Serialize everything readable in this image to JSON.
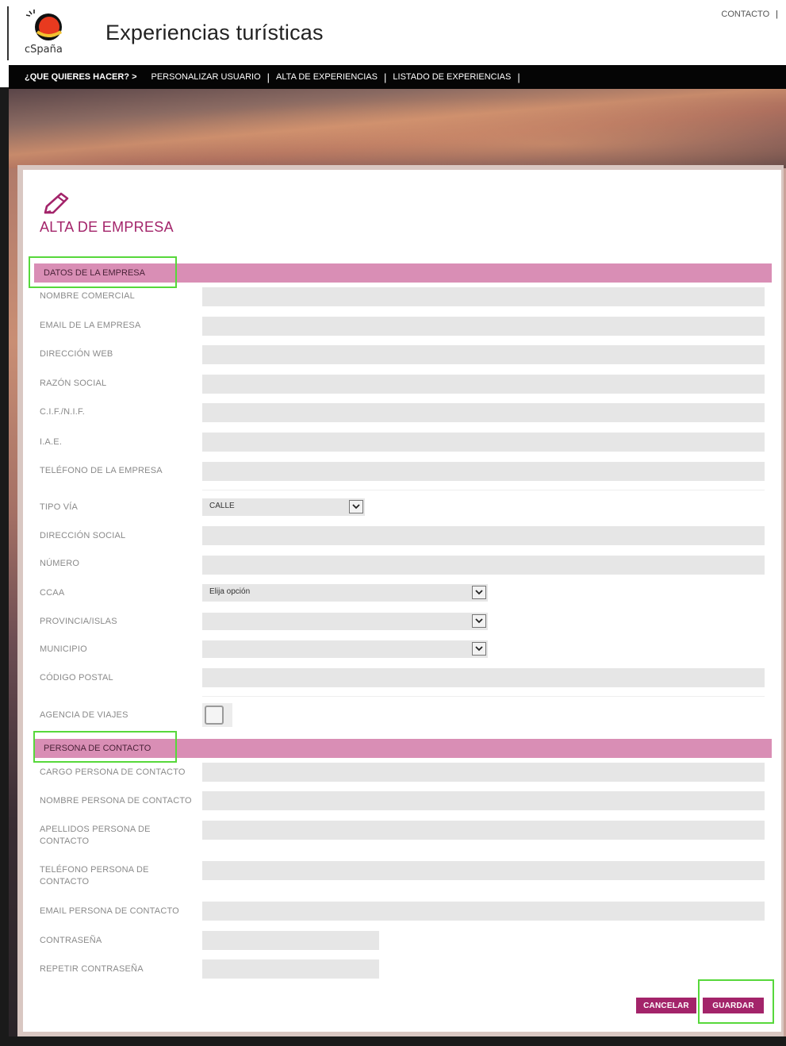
{
  "header": {
    "site_title": "Experiencias turísticas",
    "contact_link": "CONTACTO",
    "contact_separator": "|",
    "logo_icon": "spain-sun-logo-icon"
  },
  "nav": {
    "question": "¿QUE QUIERES HACER? >",
    "items": [
      {
        "label": "PERSONALIZAR USUARIO"
      },
      {
        "label": "ALTA DE EXPERIENCIAS"
      },
      {
        "label": "LISTADO DE EXPERIENCIAS"
      }
    ],
    "separator": "|"
  },
  "page": {
    "title": "ALTA DE EMPRESA",
    "title_icon": "pencil-icon",
    "accent_color": "#a3246a",
    "section_color": "#d98eb5"
  },
  "sections": {
    "empresa": {
      "label": "DATOS DE LA EMPRESA",
      "fields": [
        {
          "label": "NOMBRE COMERCIAL",
          "value": ""
        },
        {
          "label": "EMAIL DE LA EMPRESA",
          "value": ""
        },
        {
          "label": "DIRECCIÓN WEB",
          "value": ""
        },
        {
          "label": "RAZÓN SOCIAL",
          "value": ""
        },
        {
          "label": "C.I.F./N.I.F.",
          "value": ""
        },
        {
          "label": "I.A.E.",
          "value": ""
        },
        {
          "label": "TELÉFONO DE LA EMPRESA",
          "value": ""
        }
      ],
      "address": {
        "tipo_via": {
          "label": "TIPO VÍA",
          "selected": "CALLE"
        },
        "direccion_social": {
          "label": "DIRECCIÓN SOCIAL",
          "value": ""
        },
        "numero": {
          "label": "NÚMERO",
          "value": ""
        },
        "ccaa": {
          "label": "CCAA",
          "selected": "Elija opción"
        },
        "provincia": {
          "label": "PROVINCIA/ISLAS",
          "selected": ""
        },
        "municipio": {
          "label": "MUNICIPIO",
          "selected": ""
        },
        "codigo_postal": {
          "label": "CÓDIGO POSTAL",
          "value": ""
        }
      },
      "agencia": {
        "label": "AGENCIA DE VIAJES",
        "checked": false
      }
    },
    "contacto": {
      "label": "PERSONA DE CONTACTO",
      "fields": [
        {
          "label": "CARGO PERSONA DE CONTACTO",
          "value": ""
        },
        {
          "label": "NOMBRE PERSONA DE CONTACTO",
          "value": ""
        },
        {
          "label": "APELLIDOS PERSONA DE CONTACTO",
          "value": ""
        },
        {
          "label": "TELÉFONO PERSONA DE CONTACTO",
          "value": ""
        },
        {
          "label": "EMAIL PERSONA DE CONTACTO",
          "value": ""
        },
        {
          "label": "CONTRASEÑA",
          "value": ""
        },
        {
          "label": "REPETIR CONTRASEÑA",
          "value": ""
        }
      ]
    }
  },
  "actions": {
    "cancel": "CANCELAR",
    "save": "GUARDAR"
  }
}
